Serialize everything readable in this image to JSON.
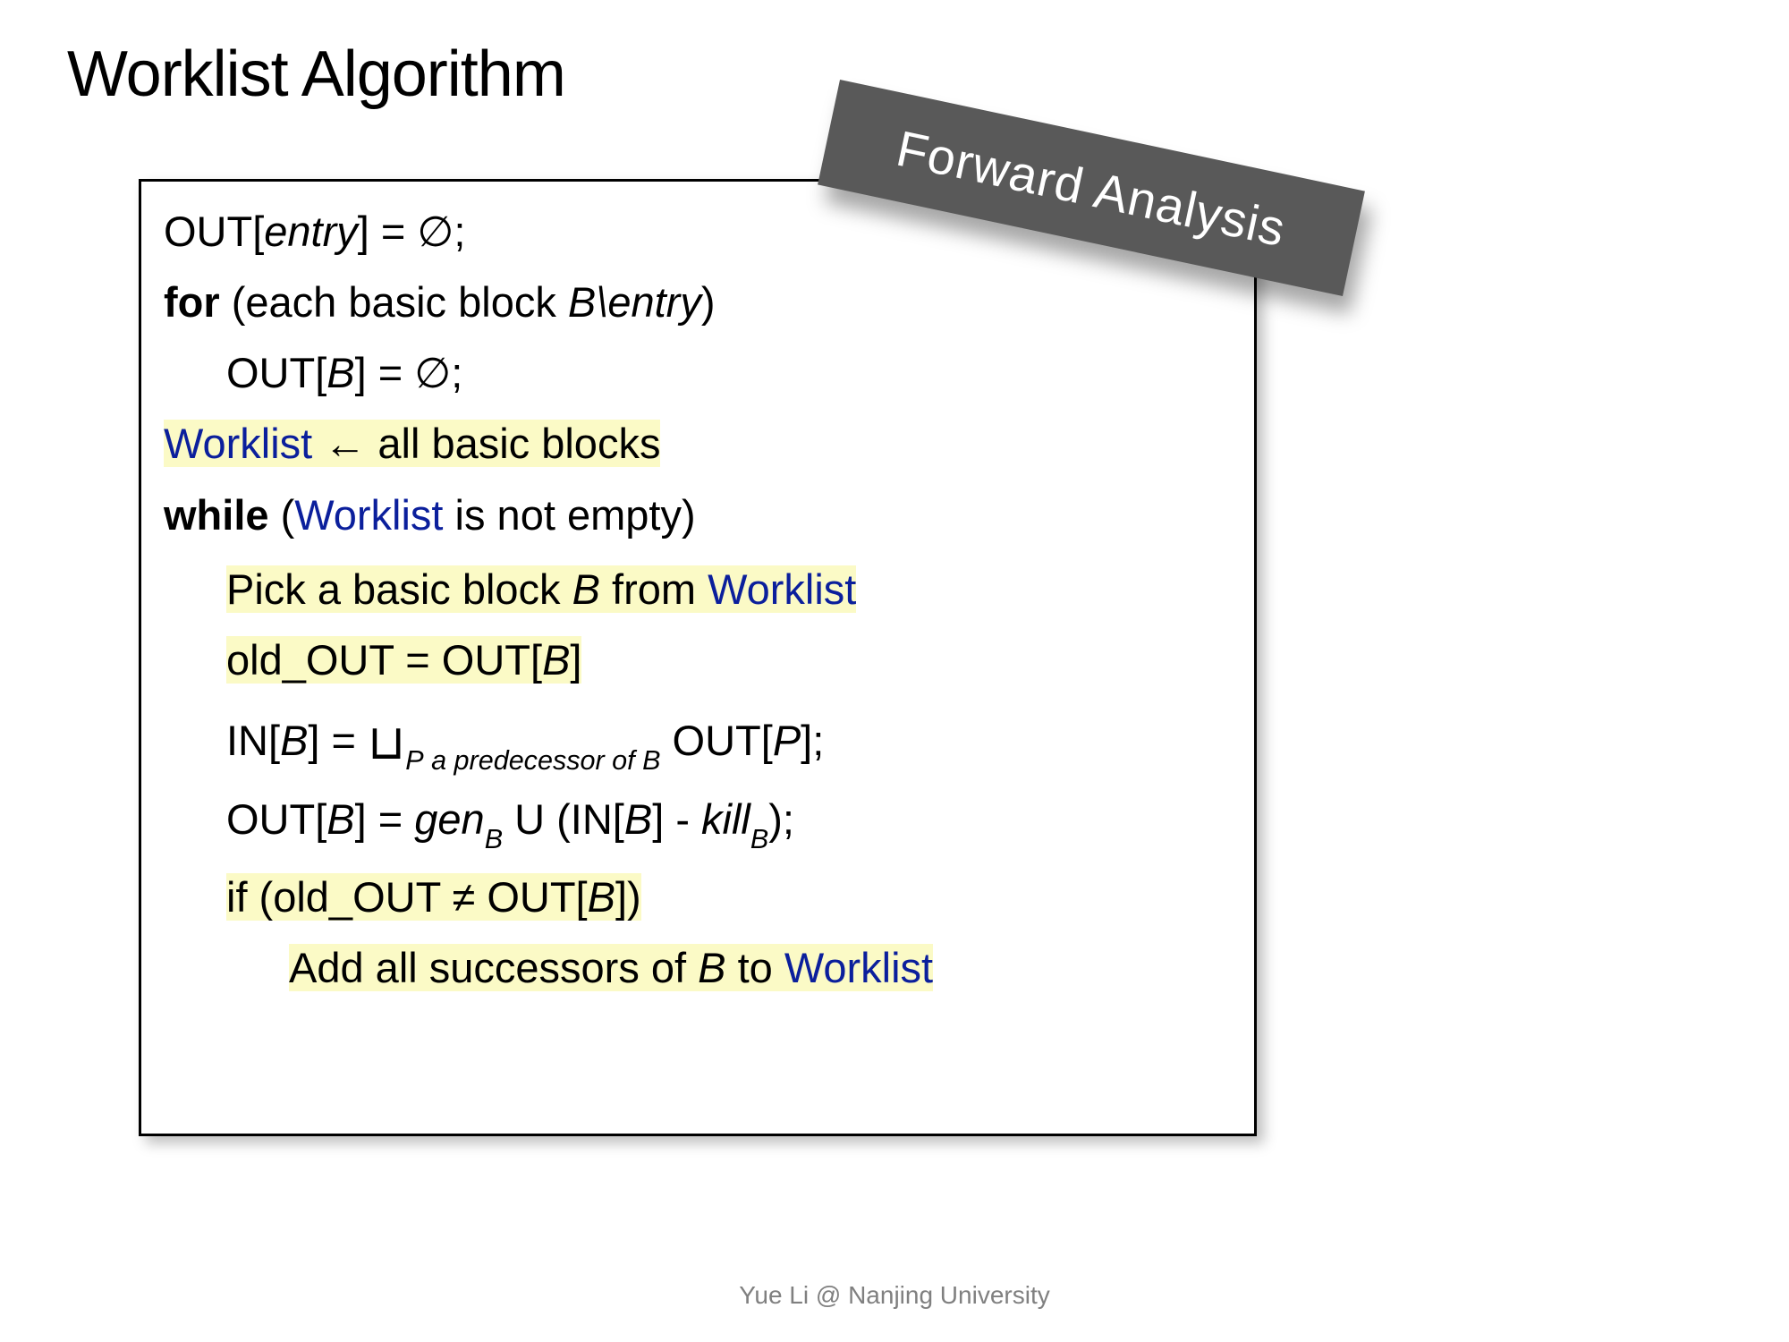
{
  "title": "Worklist Algorithm",
  "badge": "Forward Analysis",
  "footer": "Yue Li @ Nanjing University",
  "algo": {
    "l1": {
      "out": "OUT[",
      "entry": "entry",
      "eq": "] = ∅;"
    },
    "l2": {
      "for": "for",
      "paren_open": " (each basic block ",
      "B": "B",
      "slash": "\\",
      "entry": "entry",
      "close": ")"
    },
    "l3": {
      "out": "OUT[",
      "B": "B",
      "eq": "] = ∅;"
    },
    "l4": {
      "worklist": "Worklist",
      "arrow": " ← all basic blocks"
    },
    "l5": {
      "while": "while",
      "paren_open": " (",
      "worklist": "Worklist",
      "rest": " is not empty)"
    },
    "l6": {
      "pick": "Pick a basic block ",
      "B": "B",
      "from": " from ",
      "worklist": "Worklist"
    },
    "l7": {
      "old": "old_OUT = OUT[",
      "B": "B",
      "close": "]"
    },
    "l8": {
      "in": "IN[",
      "B": "B",
      "eq": "] = ",
      "join": "⊔",
      "sub_P": "P",
      "sub_txt": " a predecessor of B",
      "out": " OUT[",
      "P": "P",
      "close": "];"
    },
    "l9": {
      "out": "OUT[",
      "B1": "B",
      "eq": "] = ",
      "gen": "gen",
      "sub_B1": "B",
      "union": " U (IN[",
      "B2": "B",
      "minus": "] - ",
      "kill": "kill",
      "sub_B2": "B",
      "close": ");"
    },
    "l10": {
      "if": "if (old_OUT ≠ OUT[",
      "B": "B",
      "close": "])"
    },
    "l11": {
      "add": "Add all successors of ",
      "B": "B",
      "to": " to ",
      "worklist": "Worklist"
    }
  }
}
